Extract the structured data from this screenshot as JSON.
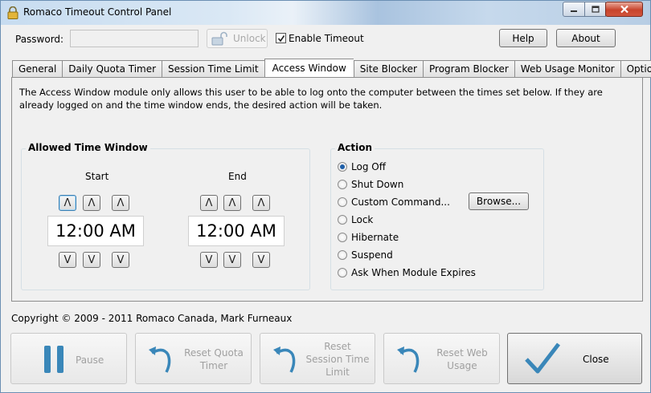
{
  "window": {
    "title": "Romaco Timeout Control Panel"
  },
  "top": {
    "password_label": "Password:",
    "password_value": "",
    "unlock_label": "Unlock",
    "enable_timeout_label": "Enable Timeout",
    "enable_timeout_checked": true,
    "help_label": "Help",
    "about_label": "About"
  },
  "tabs": [
    {
      "label": "General",
      "active": false
    },
    {
      "label": "Daily Quota Timer",
      "active": false
    },
    {
      "label": "Session Time Limit",
      "active": false
    },
    {
      "label": "Access Window",
      "active": true
    },
    {
      "label": "Site Blocker",
      "active": false
    },
    {
      "label": "Program Blocker",
      "active": false
    },
    {
      "label": "Web Usage Monitor",
      "active": false
    },
    {
      "label": "Options",
      "active": false
    }
  ],
  "panel": {
    "description": "The Access Window module only allows this user to be able to log onto the computer between the times set below. If they are already logged on and the time window ends, the desired action will be taken.",
    "time_window": {
      "title": "Allowed Time Window",
      "start_label": "Start",
      "end_label": "End",
      "start_value": "12:00 AM",
      "end_value": "12:00 AM",
      "up_glyph": "Λ",
      "down_glyph": "V"
    },
    "action": {
      "title": "Action",
      "options": [
        {
          "label": "Log Off",
          "selected": true
        },
        {
          "label": "Shut Down",
          "selected": false
        },
        {
          "label": "Custom Command...",
          "selected": false
        },
        {
          "label": "Lock",
          "selected": false
        },
        {
          "label": "Hibernate",
          "selected": false
        },
        {
          "label": "Suspend",
          "selected": false
        },
        {
          "label": "Ask When Module Expires",
          "selected": false
        }
      ],
      "browse_label": "Browse..."
    }
  },
  "copyright": "Copyright © 2009 - 2011 Romaco Canada, Mark Furneaux",
  "bottom_buttons": {
    "pause": "Pause",
    "reset_quota": "Reset Quota Timer",
    "reset_session": "Reset Session Time Limit",
    "reset_web": "Reset Web Usage",
    "close": "Close"
  },
  "colors": {
    "accent": "#2e7fb3",
    "disabled_text": "#a0a0a0"
  }
}
